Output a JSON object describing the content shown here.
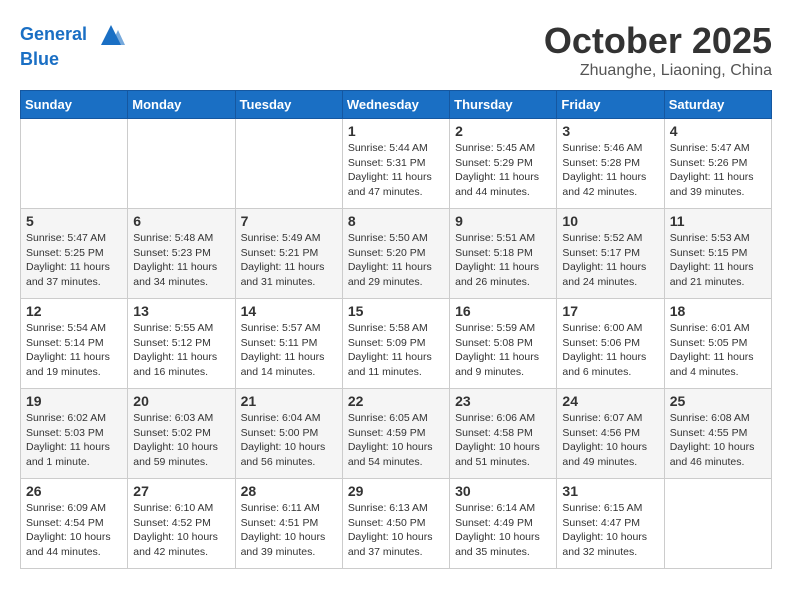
{
  "header": {
    "logo_line1": "General",
    "logo_line2": "Blue",
    "month_title": "October 2025",
    "location": "Zhuanghe, Liaoning, China"
  },
  "weekdays": [
    "Sunday",
    "Monday",
    "Tuesday",
    "Wednesday",
    "Thursday",
    "Friday",
    "Saturday"
  ],
  "weeks": [
    [
      {
        "day": "",
        "info": ""
      },
      {
        "day": "",
        "info": ""
      },
      {
        "day": "",
        "info": ""
      },
      {
        "day": "1",
        "info": "Sunrise: 5:44 AM\nSunset: 5:31 PM\nDaylight: 11 hours\nand 47 minutes."
      },
      {
        "day": "2",
        "info": "Sunrise: 5:45 AM\nSunset: 5:29 PM\nDaylight: 11 hours\nand 44 minutes."
      },
      {
        "day": "3",
        "info": "Sunrise: 5:46 AM\nSunset: 5:28 PM\nDaylight: 11 hours\nand 42 minutes."
      },
      {
        "day": "4",
        "info": "Sunrise: 5:47 AM\nSunset: 5:26 PM\nDaylight: 11 hours\nand 39 minutes."
      }
    ],
    [
      {
        "day": "5",
        "info": "Sunrise: 5:47 AM\nSunset: 5:25 PM\nDaylight: 11 hours\nand 37 minutes."
      },
      {
        "day": "6",
        "info": "Sunrise: 5:48 AM\nSunset: 5:23 PM\nDaylight: 11 hours\nand 34 minutes."
      },
      {
        "day": "7",
        "info": "Sunrise: 5:49 AM\nSunset: 5:21 PM\nDaylight: 11 hours\nand 31 minutes."
      },
      {
        "day": "8",
        "info": "Sunrise: 5:50 AM\nSunset: 5:20 PM\nDaylight: 11 hours\nand 29 minutes."
      },
      {
        "day": "9",
        "info": "Sunrise: 5:51 AM\nSunset: 5:18 PM\nDaylight: 11 hours\nand 26 minutes."
      },
      {
        "day": "10",
        "info": "Sunrise: 5:52 AM\nSunset: 5:17 PM\nDaylight: 11 hours\nand 24 minutes."
      },
      {
        "day": "11",
        "info": "Sunrise: 5:53 AM\nSunset: 5:15 PM\nDaylight: 11 hours\nand 21 minutes."
      }
    ],
    [
      {
        "day": "12",
        "info": "Sunrise: 5:54 AM\nSunset: 5:14 PM\nDaylight: 11 hours\nand 19 minutes."
      },
      {
        "day": "13",
        "info": "Sunrise: 5:55 AM\nSunset: 5:12 PM\nDaylight: 11 hours\nand 16 minutes."
      },
      {
        "day": "14",
        "info": "Sunrise: 5:57 AM\nSunset: 5:11 PM\nDaylight: 11 hours\nand 14 minutes."
      },
      {
        "day": "15",
        "info": "Sunrise: 5:58 AM\nSunset: 5:09 PM\nDaylight: 11 hours\nand 11 minutes."
      },
      {
        "day": "16",
        "info": "Sunrise: 5:59 AM\nSunset: 5:08 PM\nDaylight: 11 hours\nand 9 minutes."
      },
      {
        "day": "17",
        "info": "Sunrise: 6:00 AM\nSunset: 5:06 PM\nDaylight: 11 hours\nand 6 minutes."
      },
      {
        "day": "18",
        "info": "Sunrise: 6:01 AM\nSunset: 5:05 PM\nDaylight: 11 hours\nand 4 minutes."
      }
    ],
    [
      {
        "day": "19",
        "info": "Sunrise: 6:02 AM\nSunset: 5:03 PM\nDaylight: 11 hours\nand 1 minute."
      },
      {
        "day": "20",
        "info": "Sunrise: 6:03 AM\nSunset: 5:02 PM\nDaylight: 10 hours\nand 59 minutes."
      },
      {
        "day": "21",
        "info": "Sunrise: 6:04 AM\nSunset: 5:00 PM\nDaylight: 10 hours\nand 56 minutes."
      },
      {
        "day": "22",
        "info": "Sunrise: 6:05 AM\nSunset: 4:59 PM\nDaylight: 10 hours\nand 54 minutes."
      },
      {
        "day": "23",
        "info": "Sunrise: 6:06 AM\nSunset: 4:58 PM\nDaylight: 10 hours\nand 51 minutes."
      },
      {
        "day": "24",
        "info": "Sunrise: 6:07 AM\nSunset: 4:56 PM\nDaylight: 10 hours\nand 49 minutes."
      },
      {
        "day": "25",
        "info": "Sunrise: 6:08 AM\nSunset: 4:55 PM\nDaylight: 10 hours\nand 46 minutes."
      }
    ],
    [
      {
        "day": "26",
        "info": "Sunrise: 6:09 AM\nSunset: 4:54 PM\nDaylight: 10 hours\nand 44 minutes."
      },
      {
        "day": "27",
        "info": "Sunrise: 6:10 AM\nSunset: 4:52 PM\nDaylight: 10 hours\nand 42 minutes."
      },
      {
        "day": "28",
        "info": "Sunrise: 6:11 AM\nSunset: 4:51 PM\nDaylight: 10 hours\nand 39 minutes."
      },
      {
        "day": "29",
        "info": "Sunrise: 6:13 AM\nSunset: 4:50 PM\nDaylight: 10 hours\nand 37 minutes."
      },
      {
        "day": "30",
        "info": "Sunrise: 6:14 AM\nSunset: 4:49 PM\nDaylight: 10 hours\nand 35 minutes."
      },
      {
        "day": "31",
        "info": "Sunrise: 6:15 AM\nSunset: 4:47 PM\nDaylight: 10 hours\nand 32 minutes."
      },
      {
        "day": "",
        "info": ""
      }
    ]
  ]
}
